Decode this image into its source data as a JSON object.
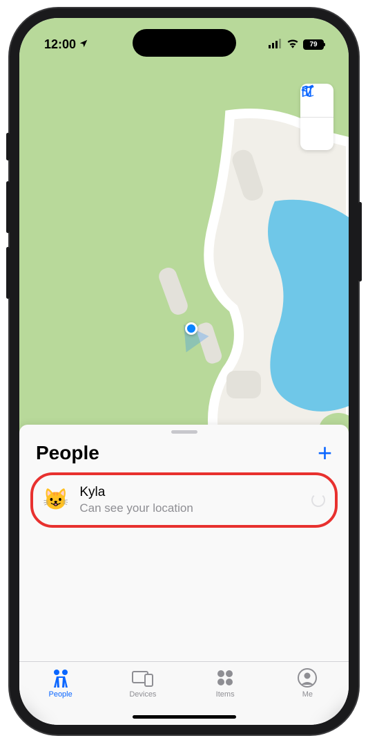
{
  "status": {
    "time": "12:00",
    "battery": "79"
  },
  "map_controls": {
    "mode_icon": "map-icon",
    "track_icon": "location-arrow-icon"
  },
  "sheet": {
    "title": "People",
    "add_label": "+",
    "person": {
      "avatar": "😺",
      "name": "Kyla",
      "subtitle": "Can see your location"
    }
  },
  "tabs": [
    {
      "label": "People",
      "icon": "people-icon",
      "active": true
    },
    {
      "label": "Devices",
      "icon": "devices-icon",
      "active": false
    },
    {
      "label": "Items",
      "icon": "items-icon",
      "active": false
    },
    {
      "label": "Me",
      "icon": "me-icon",
      "active": false
    }
  ],
  "colors": {
    "accent": "#0a66ff",
    "map_green": "#b8d99a",
    "highlight_ring": "#e8312f"
  }
}
